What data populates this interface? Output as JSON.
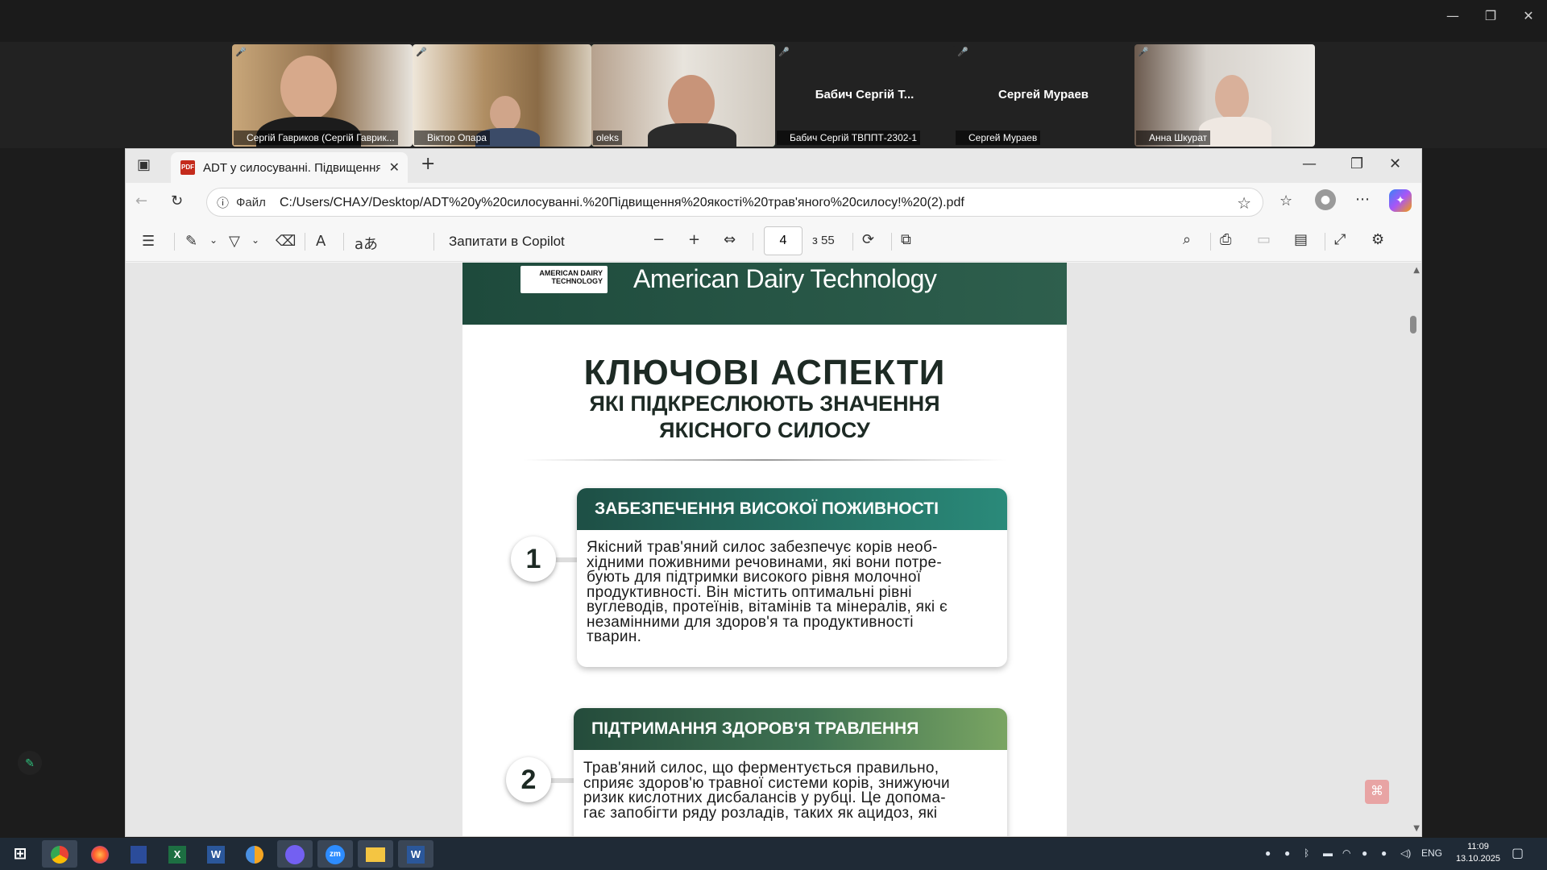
{
  "zoom_window": {
    "controls": [
      "—",
      "❐",
      "✕"
    ]
  },
  "participants": [
    {
      "name": "Сергій Гавриков (Сергій Гаврик...",
      "muted": true
    },
    {
      "name": "Віктор Опара",
      "muted": true
    },
    {
      "name": "oleks",
      "muted": false,
      "active": true
    },
    {
      "name": "Бабич Сергій ТВППТ-2302-1",
      "display": "Бабич  Сергій Т...",
      "muted": true
    },
    {
      "name": "Сергей Мураев",
      "display": "Сергей Мураев",
      "muted": true
    },
    {
      "name": "Анна Шкурат",
      "muted": true
    }
  ],
  "browser": {
    "tab_title": "ADT у силосуванні. Підвищення якості",
    "tab_favicon": "PDF",
    "file_label": "Файл",
    "url": "C:/Users/CHAУ/Desktop/ADT%20у%20силосуванні.%20Підвищення%20якості%20трав'яного%20силосу!%20(2).pdf",
    "window_controls": [
      "—",
      "❐",
      "✕"
    ]
  },
  "pdf_toolbar": {
    "copilot_label": "Запитати в Copilot",
    "page_current": "4",
    "page_total": "з 55"
  },
  "pdf_page": {
    "logo_text": "AMERICAN DAIRY TECHNOLOGY",
    "brand": "American Dairy Technology",
    "heading": "КЛЮЧОВІ АСПЕКТИ",
    "subheading_1": "ЯКІ ПІДКРЕСЛЮЮТЬ ЗНАЧЕННЯ",
    "subheading_2": "ЯКІСНОГО СИЛОСУ",
    "items": [
      {
        "number": "1",
        "title": "ЗАБЕЗПЕЧЕННЯ ВИСОКОЇ ПОЖИВНОСТІ",
        "lines": [
          "Якісний трав'яний силос забезпечує корів необ-",
          "хідними поживними речовинами, які вони потре-",
          "бують для підтримки високого рівня молочної",
          "продуктивності. Він містить оптимальні рівні",
          "вуглеводів, протеїнів, вітамінів та мінералів, які є",
          "незамінними для здоров'я та продуктивності",
          "тварин."
        ]
      },
      {
        "number": "2",
        "title": "ПІДТРИМАННЯ ЗДОРОВ'Я ТРАВЛЕННЯ",
        "lines": [
          "Трав'яний силос, що ферментується правильно,",
          "сприяє здоров'ю травної системи корів, знижуючи",
          "ризик кислотних дисбалансів у рубці. Це допома-",
          "гає запобігти ряду розладів, таких як ацидоз, які"
        ]
      }
    ]
  },
  "taskbar": {
    "apps": [
      "⊞",
      "Chrome",
      "Firefox",
      "Calendar",
      "X",
      "W",
      "Chromium",
      "Viber",
      "zm",
      "Explorer",
      "W"
    ],
    "lang": "ENG",
    "time": "11:09",
    "date": "13.10.2025"
  },
  "colors": {
    "banner": "#2e5f4d",
    "card1_head": "#1f6b5c",
    "card2_head_start": "#244b3b",
    "card2_head_end": "#7aa563",
    "active_speaker": "#2ec27e"
  }
}
